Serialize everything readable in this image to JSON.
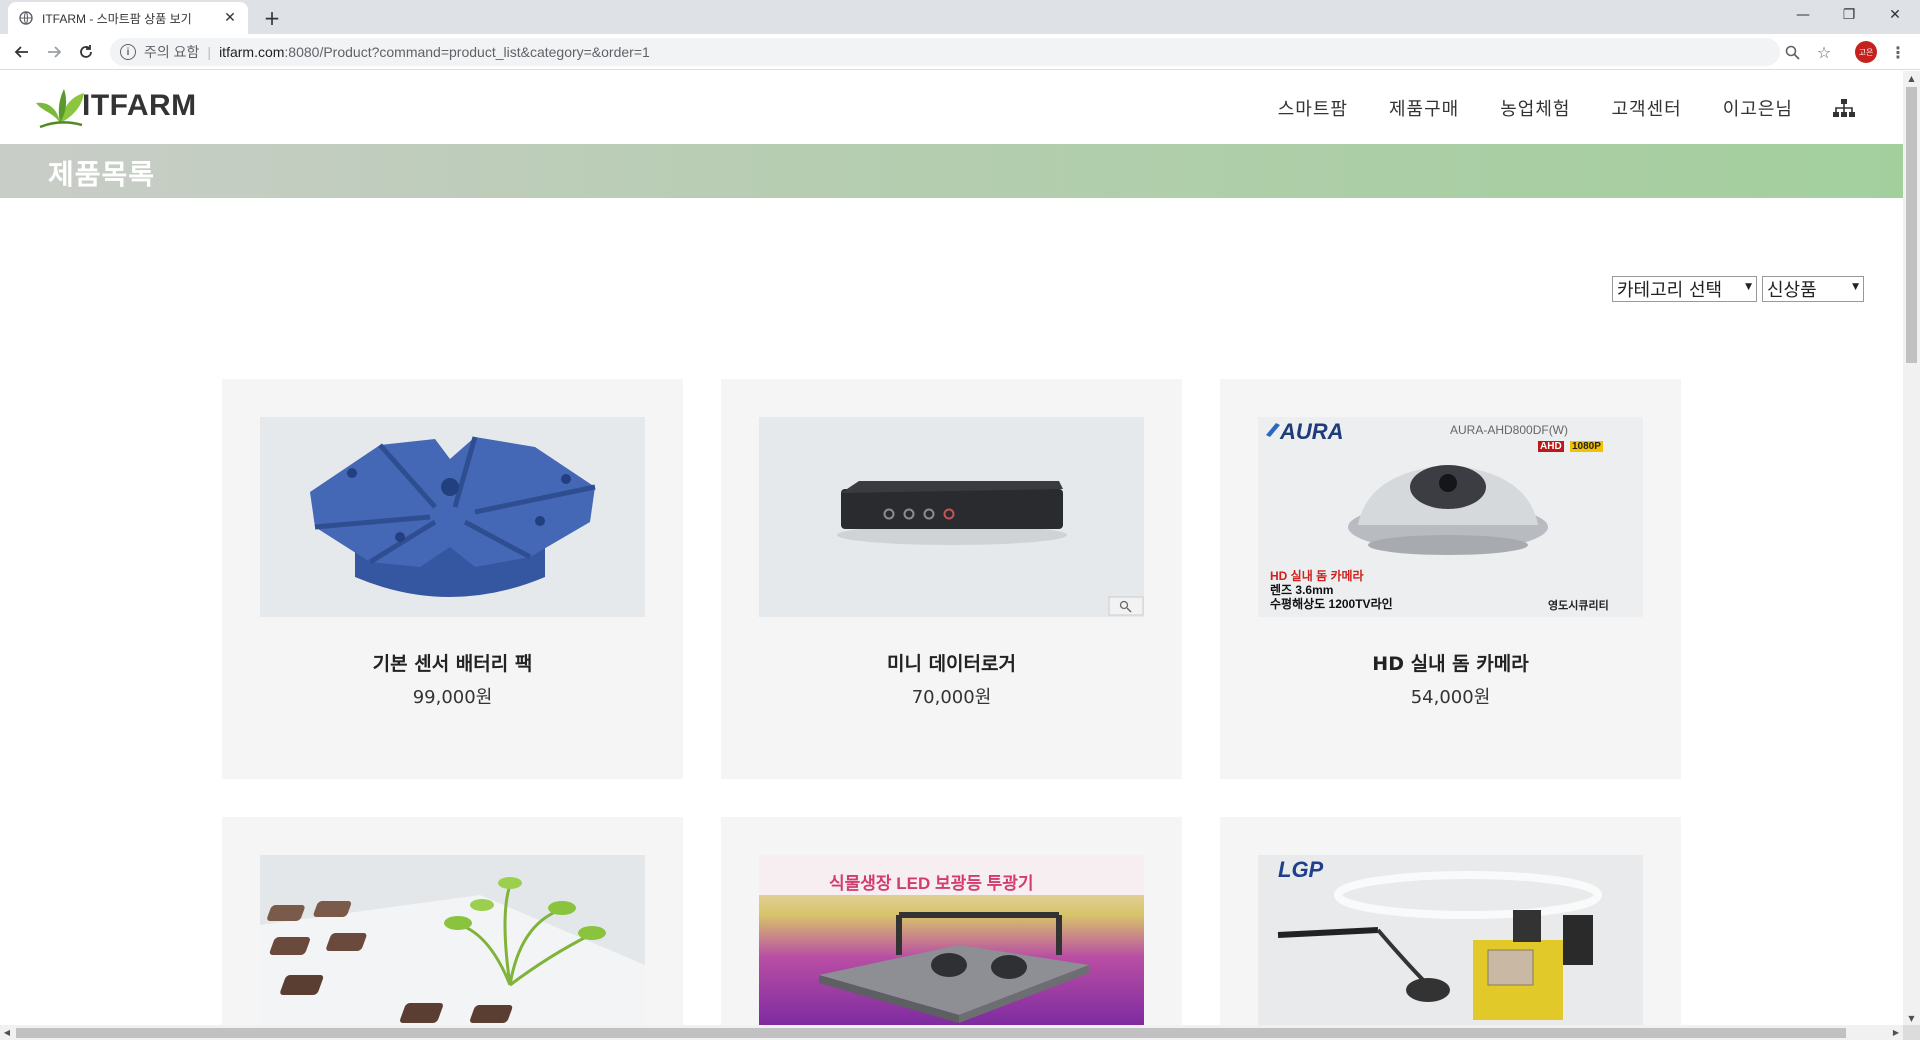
{
  "browser": {
    "tab_title": "ITFARM - 스마트팜 상품 보기",
    "tab_close": "✕",
    "new_tab": "+",
    "security_label": "주의 요함",
    "url_host": "itfarm.com",
    "url_rest": ":8080/Product?command=product_list&category=&order=1",
    "profile_initials": "고은",
    "icons": [
      "globe-icon",
      "back-icon",
      "forward-icon",
      "reload-icon",
      "info-icon",
      "zoom-icon",
      "star-icon",
      "menu-icon"
    ]
  },
  "header": {
    "logo_text": "ITFARM",
    "nav": [
      "스마트팜",
      "제품구매",
      "농업체험",
      "고객센터",
      "이고은님"
    ]
  },
  "page": {
    "title": "제품목록",
    "category_select": "카테고리 선택",
    "order_select": "신상품"
  },
  "products": [
    {
      "name": "기본 센서 배터리 팩",
      "price": "99,000원"
    },
    {
      "name": "미니 데이터로거",
      "price": "70,000원"
    },
    {
      "name": "HD 실내 돔 카메라",
      "price": "54,000원"
    },
    {
      "name": "",
      "price": ""
    },
    {
      "name": "",
      "price": ""
    },
    {
      "name": "",
      "price": ""
    }
  ],
  "image_text": {
    "camera_brand": "AURA",
    "camera_model": "AURA-AHD800DF(W)",
    "camera_badge_1": "AHD",
    "camera_badge_2": "1080P",
    "camera_line1": "HD 실내 돔 카메라",
    "camera_line2": "렌즈 3.6mm",
    "camera_line3": "수평해상도 1200TV라인",
    "camera_vendor": "영도시큐리티",
    "led_title": "식물생장 LED 보광등 투광기",
    "pump_brand": "LGP"
  },
  "colors": {
    "banner_start": "#c9cdc8",
    "banner_end": "#a3cf9d",
    "logo_leaf": "#7ab93a",
    "product_blue": "#3f66b0"
  }
}
